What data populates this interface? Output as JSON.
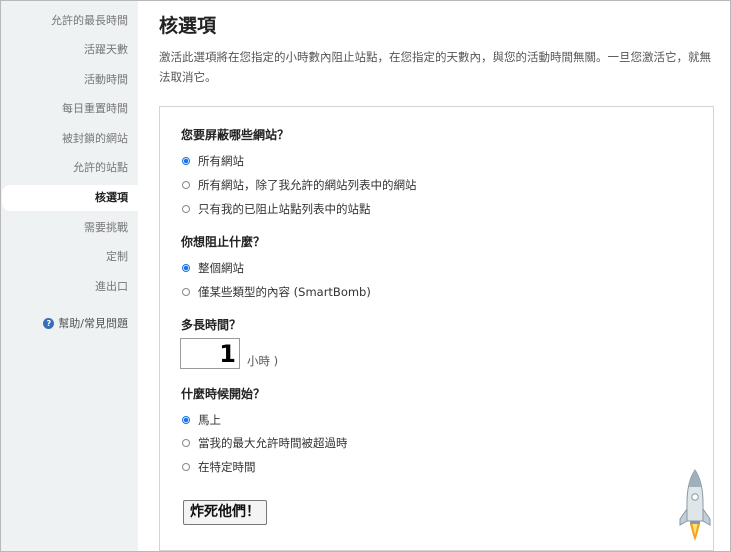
{
  "sidebar": {
    "items": [
      {
        "label": "允許的最長時間",
        "active": false
      },
      {
        "label": "活躍天數",
        "active": false
      },
      {
        "label": "活動時間",
        "active": false
      },
      {
        "label": "每日重置時間",
        "active": false
      },
      {
        "label": "被封鎖的網站",
        "active": false
      },
      {
        "label": "允許的站點",
        "active": false
      },
      {
        "label": "核選項",
        "active": true
      },
      {
        "label": "需要挑戰",
        "active": false
      },
      {
        "label": "定制",
        "active": false
      },
      {
        "label": "進出口",
        "active": false
      }
    ],
    "help": {
      "icon": "question-circle-icon",
      "label": "幫助/常見問題"
    }
  },
  "main": {
    "title": "核選項",
    "description": "激活此選項將在您指定的小時數內阻止站點，在您指定的天數內，與您的活動時間無關。一旦您激活它，就無法取消它。"
  },
  "panel": {
    "q1": {
      "label": "您要屏蔽哪些網站？",
      "options": [
        {
          "label": "所有網站",
          "checked": true
        },
        {
          "label": "所有網站，除了我允許的網站列表中的網站",
          "checked": false
        },
        {
          "label": "只有我的已阻止站點列表中的站點",
          "checked": false
        }
      ]
    },
    "q2": {
      "label": "你想阻止什麼？",
      "options": [
        {
          "label": "整個網站",
          "checked": true
        },
        {
          "label": "僅某些類型的內容 (SmartBomb)",
          "checked": false
        }
      ]
    },
    "q3": {
      "label": "多長時間？",
      "value": "1",
      "unit": "小時 )"
    },
    "q4": {
      "label": "什麼時候開始？",
      "options": [
        {
          "label": "馬上",
          "checked": true
        },
        {
          "label": "當我的最大允許時間被超過時",
          "checked": false
        },
        {
          "label": "在特定時間",
          "checked": false
        }
      ]
    },
    "button_label": "炸死他們！"
  },
  "colors": {
    "accent": "#1a73e8",
    "sidebar_bg": "#eef2f2"
  }
}
